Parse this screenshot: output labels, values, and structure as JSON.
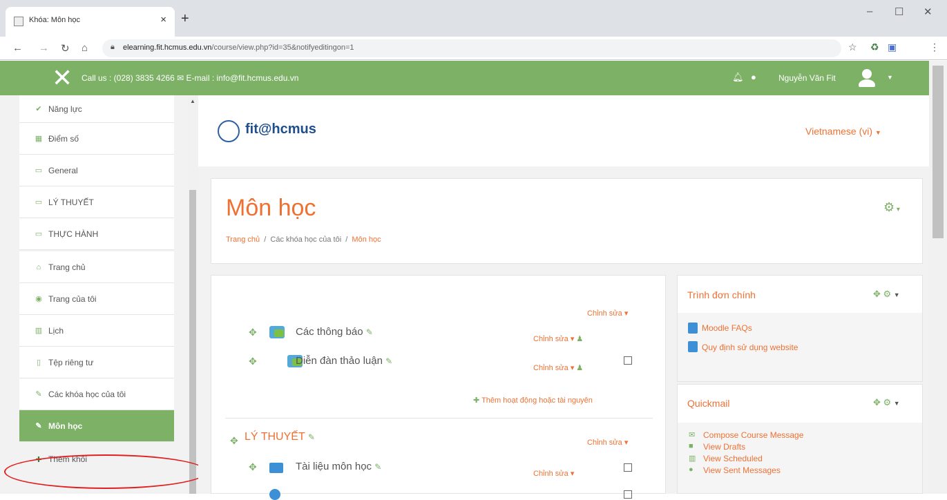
{
  "browser": {
    "tab_title": "Khóa: Môn học",
    "url_host": "elearning.fit.hcmus.edu.vn",
    "url_path": "/course/view.php?id=35&notifyeditingon=1"
  },
  "topbar": {
    "contact": "Call us : (028) 3835 4266 ✉ E-mail : info@fit.hcmus.edu.vn",
    "user": "Nguyễn Văn Fit"
  },
  "sidebar": {
    "items": [
      {
        "icon": "✔",
        "label": "Năng lực"
      },
      {
        "icon": "▦",
        "label": "Điểm số"
      },
      {
        "icon": "▭",
        "label": "General"
      },
      {
        "icon": "▭",
        "label": "LÝ THUYẾT"
      },
      {
        "icon": "▭",
        "label": "THỰC HÀNH"
      },
      {
        "icon": "⌂",
        "label": "Trang chủ"
      },
      {
        "icon": "◉",
        "label": "Trang của tôi"
      },
      {
        "icon": "▥",
        "label": "Lịch"
      },
      {
        "icon": "▯",
        "label": "Tệp riêng tư"
      },
      {
        "icon": "✎",
        "label": "Các khóa học của tôi"
      },
      {
        "icon": "✎",
        "label": "Môn học"
      },
      {
        "icon": "✚",
        "label": "Thêm khối"
      }
    ]
  },
  "header": {
    "logo": "fit@hcmus",
    "language": "Vietnamese (vi)"
  },
  "page": {
    "title": "Môn học",
    "crumb1": "Trang chủ",
    "crumb2": "Các khóa học của tôi",
    "crumb3": "Môn học"
  },
  "content": {
    "edit": "Chỉnh sửa",
    "announce": "Các thông báo",
    "forum": "Diễn đàn thảo luận",
    "add_activity": "Thêm hoạt động hoặc tài nguyên",
    "section": "LÝ THUYẾT",
    "docs": "Tài liệu môn học"
  },
  "blocks": {
    "main_menu": {
      "title": "Trình đơn chính",
      "links": [
        "Moodle FAQs",
        "Quy định sử dụng website"
      ]
    },
    "quickmail": {
      "title": "Quickmail",
      "links": [
        "Compose Course Message",
        "View Drafts",
        "View Scheduled",
        "View Sent Messages"
      ]
    }
  }
}
